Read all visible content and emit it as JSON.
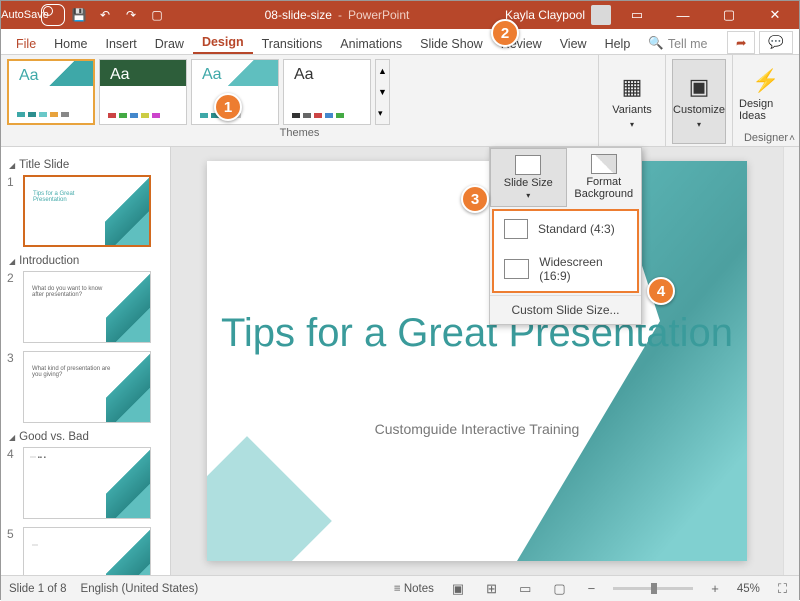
{
  "titlebar": {
    "autosave_label": "AutoSave",
    "doc_name": "08-slide-size",
    "app_name": "PowerPoint",
    "user_name": "Kayla Claypool"
  },
  "tabs": {
    "file": "File",
    "home": "Home",
    "insert": "Insert",
    "draw": "Draw",
    "design": "Design",
    "transitions": "Transitions",
    "animations": "Animations",
    "slideshow": "Slide Show",
    "review": "Review",
    "view": "View",
    "help": "Help",
    "tellme": "Tell me"
  },
  "ribbon": {
    "themes_label": "Themes",
    "variants_label": "Variants",
    "customize_label": "Customize",
    "design_ideas_label": "Design Ideas",
    "designer_label": "Designer"
  },
  "dropdown": {
    "slide_size": "Slide Size",
    "format_bg": "Format Background",
    "standard": "Standard (4:3)",
    "widescreen": "Widescreen (16:9)",
    "custom": "Custom Slide Size..."
  },
  "sections": {
    "s1": "Title Slide",
    "s2": "Introduction",
    "s3": "Good vs. Bad"
  },
  "slide": {
    "title": "Tips for a Great Presentation",
    "subtitle": "Customguide Interactive Training"
  },
  "status": {
    "slide_info": "Slide 1 of 8",
    "lang": "English (United States)",
    "notes": "Notes",
    "zoom": "45%"
  },
  "callouts": {
    "c1": "1",
    "c2": "2",
    "c3": "3",
    "c4": "4"
  }
}
